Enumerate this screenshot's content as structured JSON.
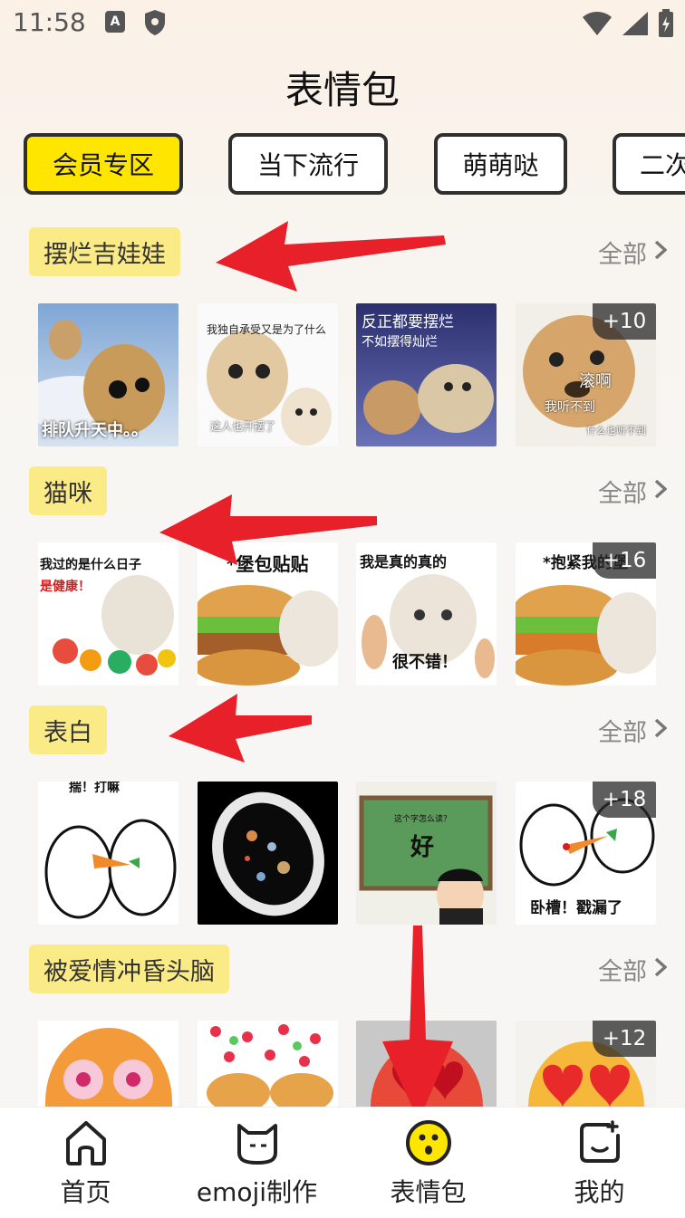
{
  "status_bar": {
    "time": "11:58",
    "a_badge": "A"
  },
  "page": {
    "title": "表情包"
  },
  "tabs": [
    {
      "label": "会员专区",
      "active": true
    },
    {
      "label": "当下流行",
      "active": false
    },
    {
      "label": "萌萌哒",
      "active": false
    },
    {
      "label": "二次",
      "active": false
    }
  ],
  "sections": [
    {
      "title": "摆烂吉娃娃",
      "all_label": "全部",
      "tiles": [
        {
          "top": "",
          "bottom": "排队升天中。。"
        },
        {
          "top": "我独自承受又是为了什么",
          "bottom": "这人也开摆了"
        },
        {
          "top": "反正都要摆烂",
          "top2": "不如摆得灿烂"
        },
        {
          "mid": "滚啊",
          "mid2": "我听不到",
          "bottom": "什么也听不到",
          "badge": "+10"
        }
      ]
    },
    {
      "title": "猫咪",
      "all_label": "全部",
      "tiles": [
        {
          "top": "我过的是什么日子",
          "top2": "是健康！"
        },
        {
          "top": "*堡包贴贴"
        },
        {
          "top": "我是真的真的",
          "bottom": "很不错！"
        },
        {
          "top": "*抱紧我的堡",
          "badge": "+16"
        }
      ]
    },
    {
      "title": "表白",
      "all_label": "全部",
      "tiles": [
        {
          "top": "揣！打嘛"
        },
        {
          "top": ""
        },
        {
          "top": "这个字怎么读？",
          "mid": "好"
        },
        {
          "bottom": "卧槽！戳漏了",
          "badge": "+18"
        }
      ]
    },
    {
      "title": "被爱情冲昏头脑",
      "all_label": "全部",
      "tiles": [
        {},
        {},
        {},
        {
          "badge": "+12"
        }
      ]
    }
  ],
  "bottom_nav": [
    {
      "label": "首页",
      "icon": "home-icon"
    },
    {
      "label": "emoji制作",
      "icon": "cat-face-icon"
    },
    {
      "label": "表情包",
      "icon": "surprised-emoji-icon",
      "active": true
    },
    {
      "label": "我的",
      "icon": "profile-face-icon"
    }
  ],
  "colors": {
    "accent_yellow": "#ffe600",
    "label_bg": "#fbeb86",
    "arrow_red": "#e8202a"
  }
}
